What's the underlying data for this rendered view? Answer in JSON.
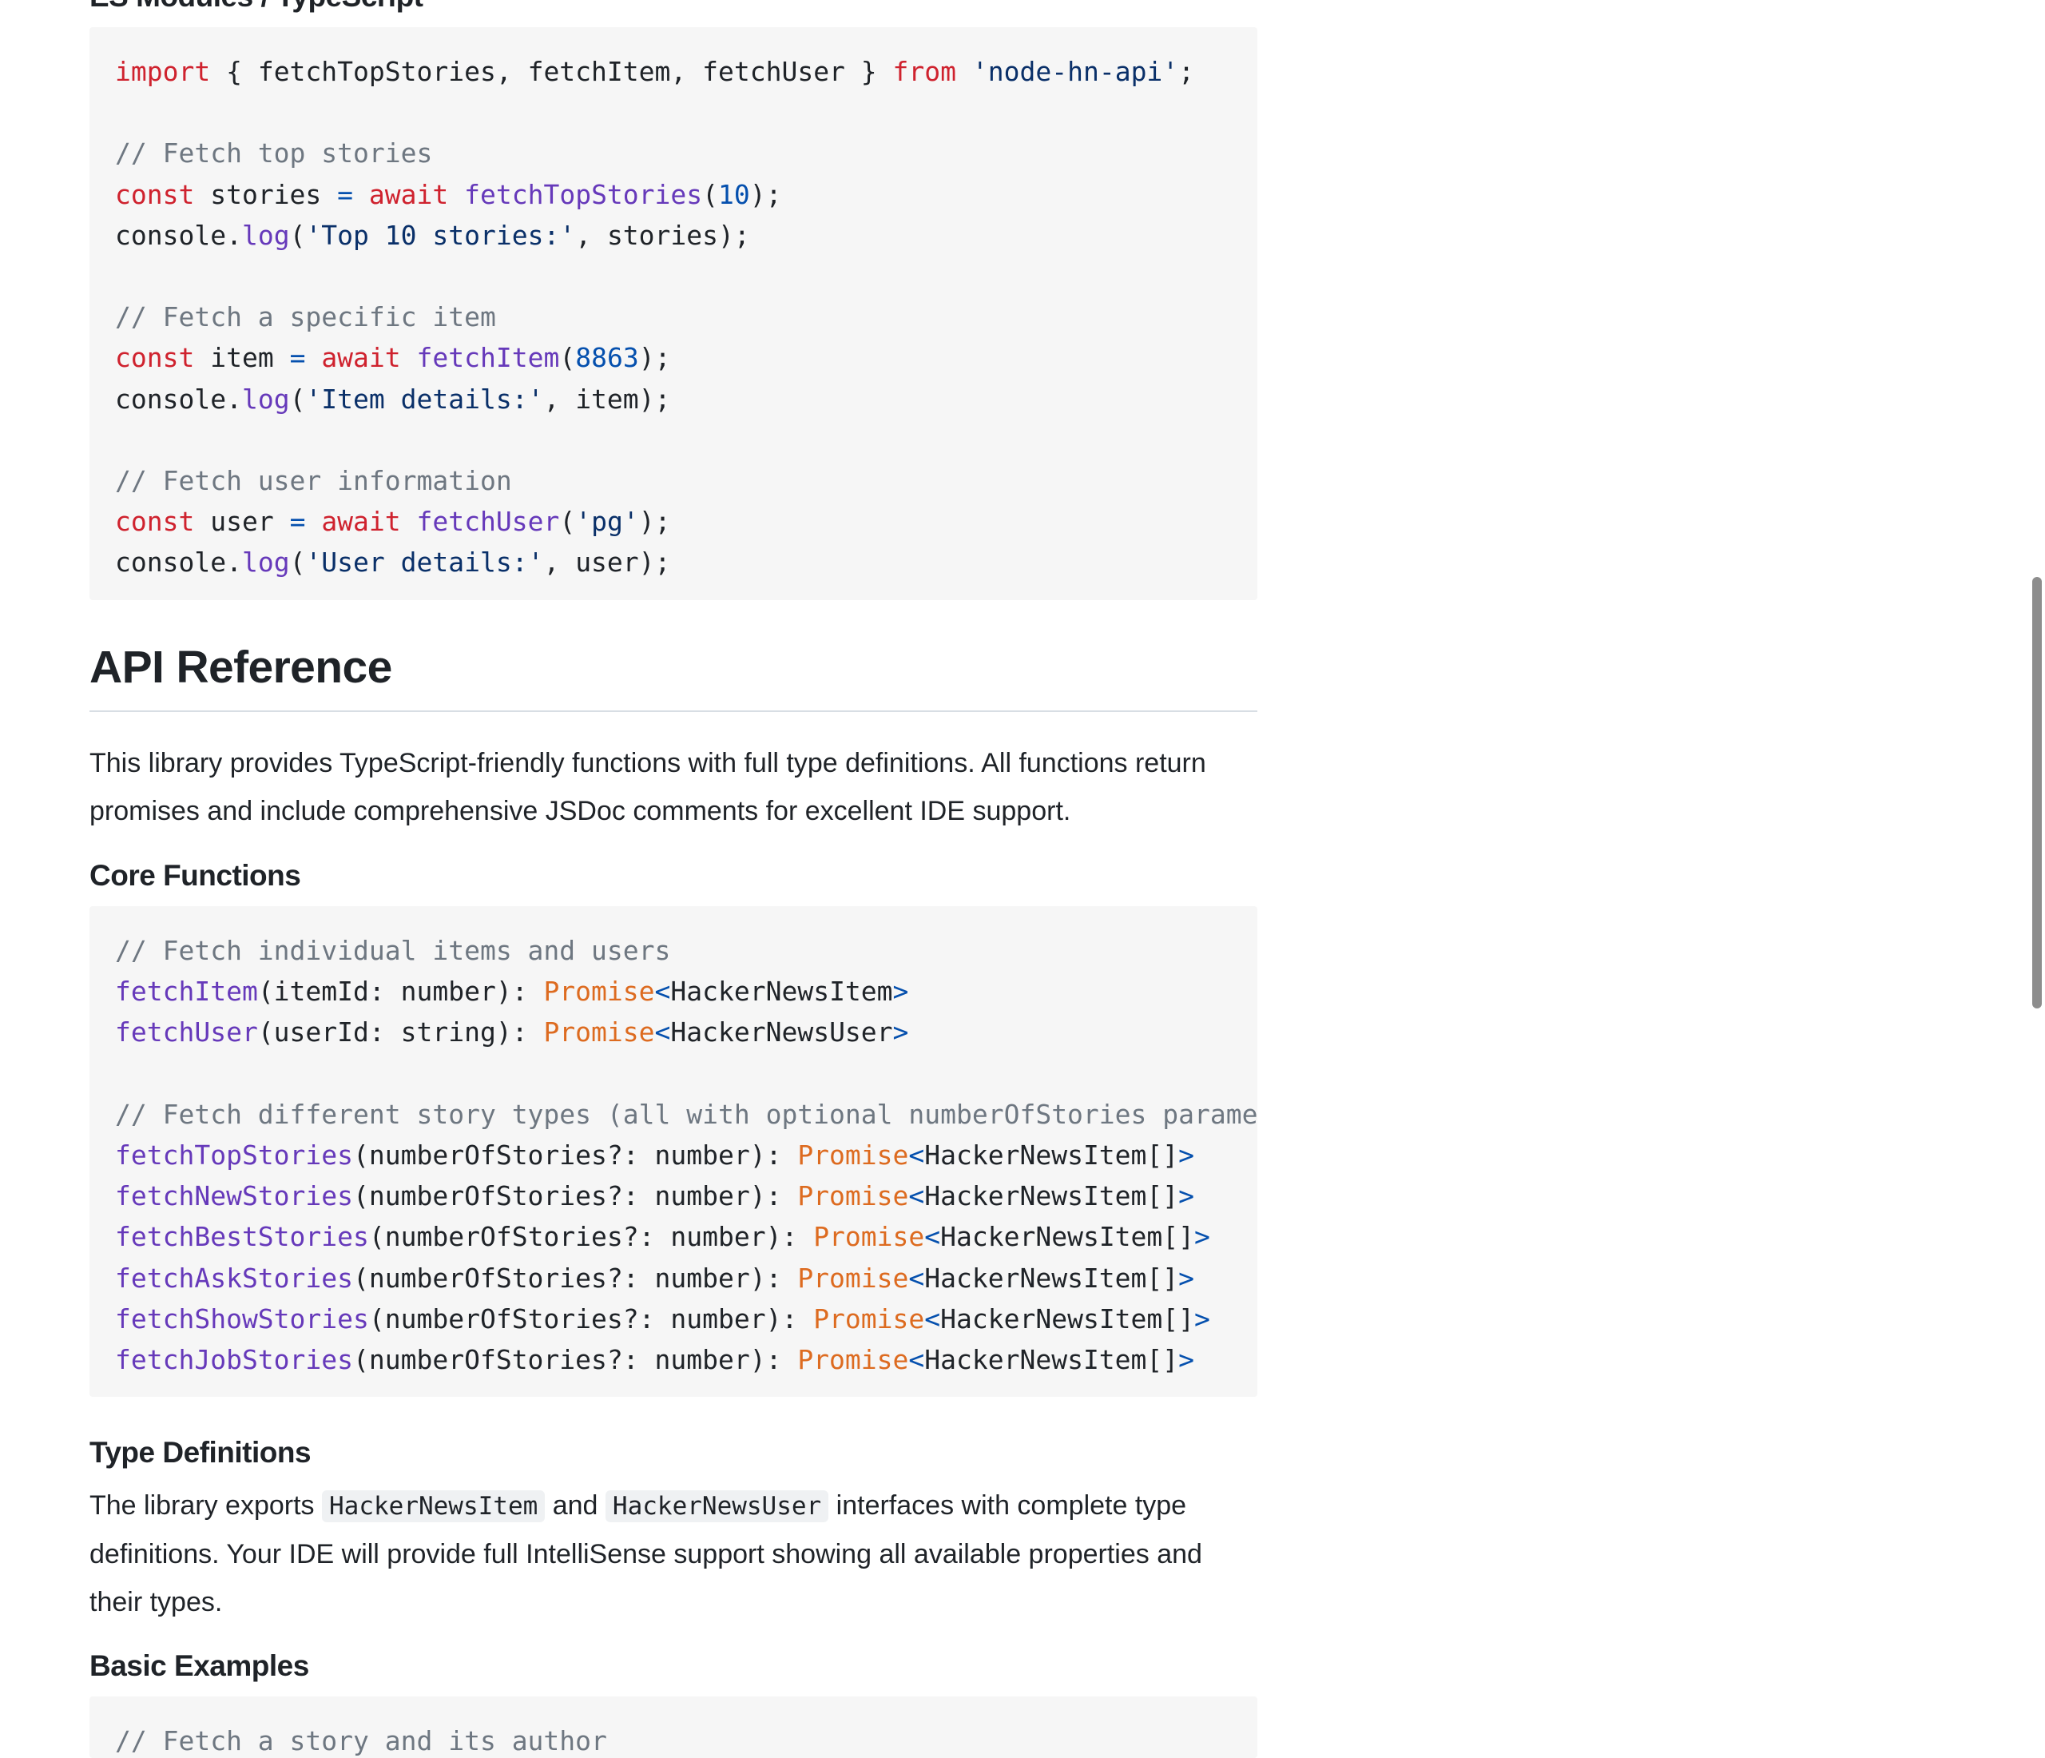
{
  "sections": {
    "es_modules_heading": "ES Modules / TypeScript",
    "api_reference_heading": "API Reference",
    "api_reference_text": "This library provides TypeScript-friendly functions with full type definitions. All functions return promises and include comprehensive JSDoc comments for excellent IDE support.",
    "core_functions_heading": "Core Functions",
    "type_definitions_heading": "Type Definitions",
    "type_definitions_text": {
      "before": "The library exports ",
      "code1": "HackerNewsItem",
      "middle": " and ",
      "code2": "HackerNewsUser",
      "after": " interfaces with complete type definitions. Your IDE will provide full IntelliSense support showing all available properties and their types."
    },
    "basic_examples_heading": "Basic Examples"
  },
  "code": {
    "es_modules": {
      "l1": {
        "kw1": "import",
        "t1": " { fetchTopStories, fetchItem, fetchUser } ",
        "kw2": "from",
        "t2": " ",
        "str": "'node-hn-api'",
        "t3": ";"
      },
      "c1": "// Fetch top stories",
      "l2": {
        "kw1": "const",
        "t1": " stories ",
        "op": "=",
        "t2": " ",
        "kw2": "await",
        "t3": " ",
        "fn": "fetchTopStories",
        "t4": "(",
        "num": "10",
        "t5": ");"
      },
      "l3": {
        "t1": "console.",
        "fn": "log",
        "t2": "(",
        "str": "'Top 10 stories:'",
        "t3": ", stories);"
      },
      "c2": "// Fetch a specific item",
      "l4": {
        "kw1": "const",
        "t1": " item ",
        "op": "=",
        "t2": " ",
        "kw2": "await",
        "t3": " ",
        "fn": "fetchItem",
        "t4": "(",
        "num": "8863",
        "t5": ");"
      },
      "l5": {
        "t1": "console.",
        "fn": "log",
        "t2": "(",
        "str": "'Item details:'",
        "t3": ", item);"
      },
      "c3": "// Fetch user information",
      "l6": {
        "kw1": "const",
        "t1": " user ",
        "op": "=",
        "t2": " ",
        "kw2": "await",
        "t3": " ",
        "fn": "fetchUser",
        "t4": "(",
        "str": "'pg'",
        "t5": ");"
      },
      "l7": {
        "t1": "console.",
        "fn": "log",
        "t2": "(",
        "str": "'User details:'",
        "t3": ", user);"
      }
    },
    "core": {
      "c1": "// Fetch individual items and users",
      "l1": {
        "fn": "fetchItem",
        "t1": "(itemId: number): ",
        "ty": "Promise",
        "lt": "<",
        "t2": "HackerNewsItem",
        "gt": ">"
      },
      "l2": {
        "fn": "fetchUser",
        "t1": "(userId: string): ",
        "ty": "Promise",
        "lt": "<",
        "t2": "HackerNewsUser",
        "gt": ">"
      },
      "c2": "// Fetch different story types (all with optional numberOfStories paramete",
      "l3": {
        "fn": "fetchTopStories",
        "t1": "(numberOfStories?: number): ",
        "ty": "Promise",
        "lt": "<",
        "t2": "HackerNewsItem[]",
        "gt": ">"
      },
      "l4": {
        "fn": "fetchNewStories",
        "t1": "(numberOfStories?: number): ",
        "ty": "Promise",
        "lt": "<",
        "t2": "HackerNewsItem[]",
        "gt": ">"
      },
      "l5": {
        "fn": "fetchBestStories",
        "t1": "(numberOfStories?: number): ",
        "ty": "Promise",
        "lt": "<",
        "t2": "HackerNewsItem[]",
        "gt": ">"
      },
      "l6": {
        "fn": "fetchAskStories",
        "t1": "(numberOfStories?: number): ",
        "ty": "Promise",
        "lt": "<",
        "t2": "HackerNewsItem[]",
        "gt": ">"
      },
      "l7": {
        "fn": "fetchShowStories",
        "t1": "(numberOfStories?: number): ",
        "ty": "Promise",
        "lt": "<",
        "t2": "HackerNewsItem[]",
        "gt": ">"
      },
      "l8": {
        "fn": "fetchJobStories",
        "t1": "(numberOfStories?: number): ",
        "ty": "Promise",
        "lt": "<",
        "t2": "HackerNewsItem[]",
        "gt": ">"
      }
    },
    "basic": {
      "c1": "// Fetch a story and its author"
    }
  },
  "colors": {
    "keyword": "#cf222e",
    "function": "#6639ba",
    "string": "#0a3069",
    "comment": "#6e7781",
    "number": "#0550ae",
    "type": "#dd6b20",
    "code_background": "#f6f6f6"
  }
}
